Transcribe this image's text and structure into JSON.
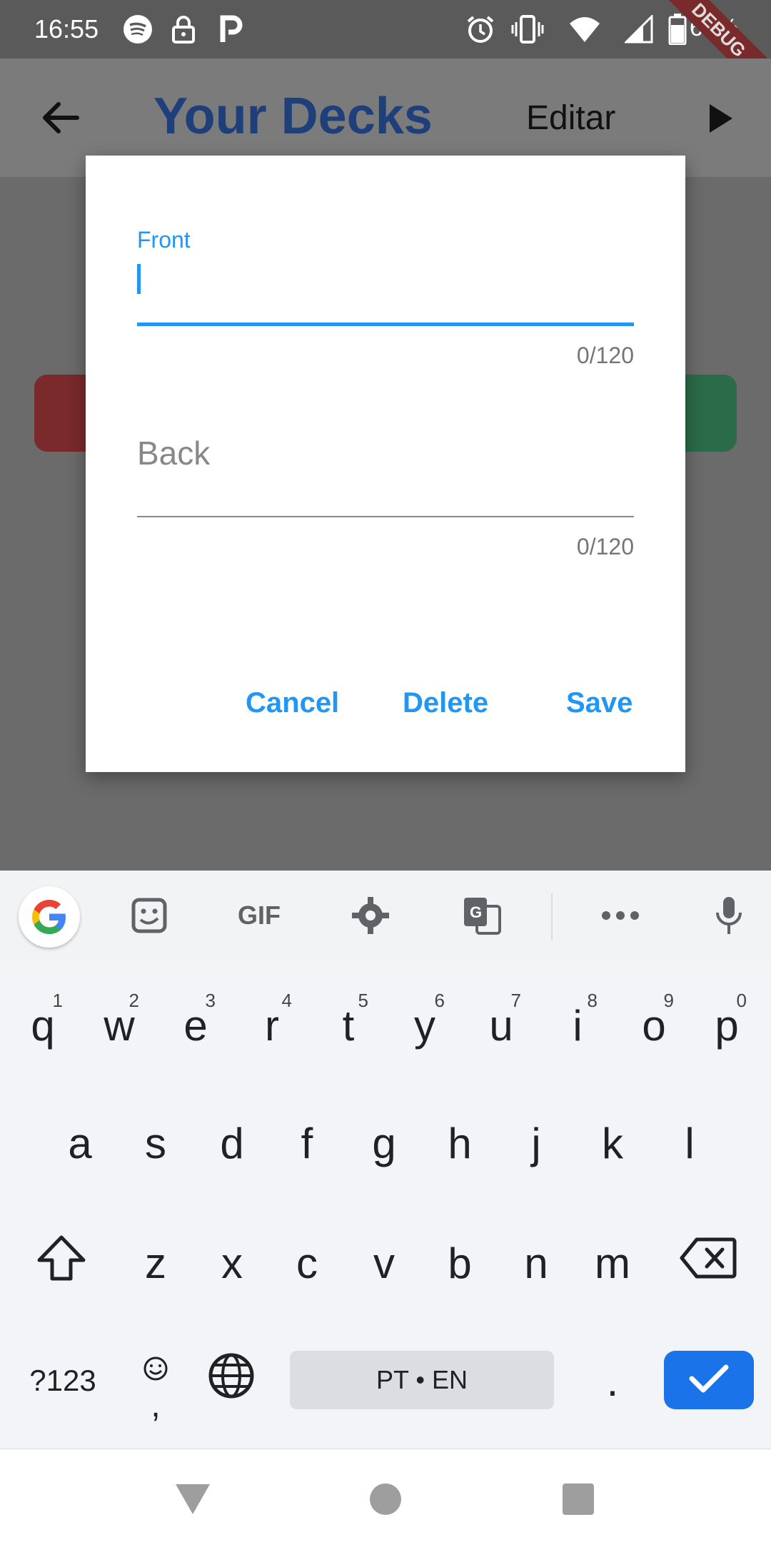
{
  "status_bar": {
    "time": "16:55",
    "battery_percent": "68%",
    "debug_label": "DEBUG",
    "icons": [
      "spotify-icon",
      "lock-icon",
      "p-icon",
      "alarm-icon",
      "vibrate-icon",
      "wifi-icon",
      "signal-icon",
      "battery-icon"
    ]
  },
  "app_bar": {
    "title": "Your Decks",
    "edit_label": "Editar"
  },
  "dialog": {
    "front": {
      "label": "Front",
      "value": "",
      "counter": "0/120"
    },
    "back": {
      "placeholder": "Back",
      "value": "",
      "counter": "0/120"
    },
    "buttons": {
      "cancel": "Cancel",
      "delete": "Delete",
      "save": "Save"
    },
    "accent_color": "#2196f3"
  },
  "keyboard": {
    "toolbar": [
      "google-icon",
      "sticker-icon",
      "gif-icon",
      "settings-icon",
      "translate-icon",
      "more-icon",
      "mic-icon"
    ],
    "gif_label": "GIF",
    "row1": [
      {
        "key": "q",
        "num": "1"
      },
      {
        "key": "w",
        "num": "2"
      },
      {
        "key": "e",
        "num": "3"
      },
      {
        "key": "r",
        "num": "4"
      },
      {
        "key": "t",
        "num": "5"
      },
      {
        "key": "y",
        "num": "6"
      },
      {
        "key": "u",
        "num": "7"
      },
      {
        "key": "i",
        "num": "8"
      },
      {
        "key": "o",
        "num": "9"
      },
      {
        "key": "p",
        "num": "0"
      }
    ],
    "row2": [
      "a",
      "s",
      "d",
      "f",
      "g",
      "h",
      "j",
      "k",
      "l"
    ],
    "row3": [
      "z",
      "x",
      "c",
      "v",
      "b",
      "n",
      "m"
    ],
    "symbols_label": "?123",
    "comma_label": ",",
    "period_label": ".",
    "space_label": "PT • EN",
    "enter_color": "#1a73e8"
  },
  "nav_bar": {
    "buttons": [
      "back-triangle-icon",
      "home-circle-icon",
      "recents-square-icon"
    ]
  }
}
